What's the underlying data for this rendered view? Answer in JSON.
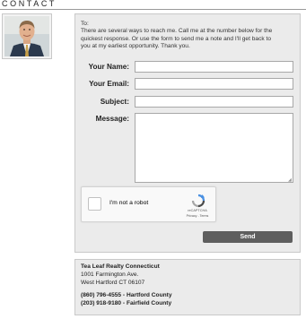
{
  "header": {
    "title": "CONTACT"
  },
  "form": {
    "intro_to": "To:",
    "intro_lines": [
      "There are several ways to reach me. Call me at the number below for the",
      "quickest response. Or use the form to send me a note and I'll get back to",
      "you at my earliest opportunity. Thank you."
    ],
    "name_label": "Your Name:",
    "name_value": "",
    "email_label": "Your Email:",
    "email_value": "",
    "subject_label": "Subject:",
    "subject_value": "",
    "message_label": "Message:",
    "message_value": "",
    "send_label": "Send"
  },
  "captcha": {
    "label": "I'm not a robot",
    "brand": "reCAPTCHA",
    "links": "Privacy - Terms",
    "checked": false
  },
  "contact": {
    "company": "Tea Leaf Realty Connecticut",
    "street": "1001 Farmington Ave.",
    "city": "West Hartford CT 06107",
    "phone_hartford": "(860) 796-4555 - Hartford County",
    "phone_fairfield": "(203) 918-9180 - Fairfield County"
  },
  "icons": {
    "captcha_logo": "recaptcha-icon",
    "resize": "resize-grip-icon"
  },
  "colors": {
    "panel_bg": "#ebebeb",
    "panel_border": "#c9c9c9",
    "button_bg": "#5e5e5e",
    "recaptcha_blue": "#4a90e2"
  }
}
